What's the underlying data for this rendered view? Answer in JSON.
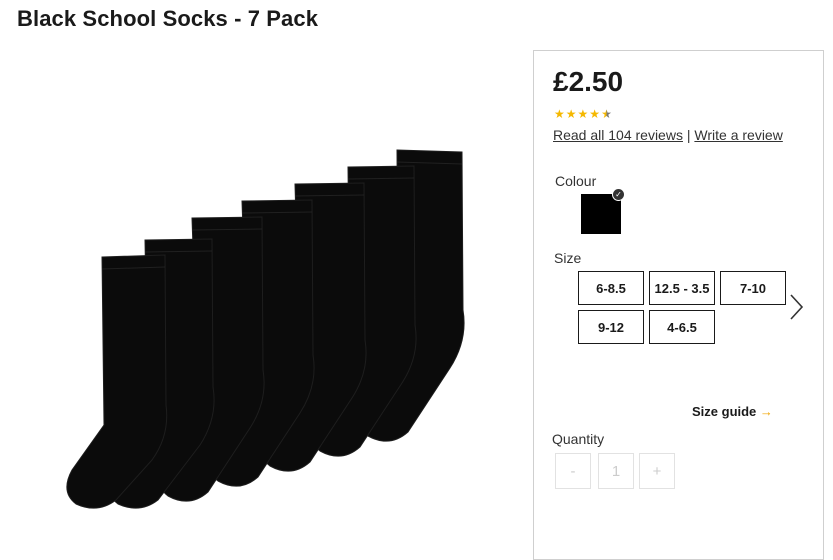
{
  "product": {
    "title": "Black School Socks - 7 Pack",
    "price": "£2.50",
    "rating": 4.5,
    "rating_max": 5,
    "reviews_link": "Read all 104 reviews",
    "separator": "|",
    "write_review": "Write a review"
  },
  "colour": {
    "label": "Colour",
    "selected": "#000000"
  },
  "size": {
    "label": "Size",
    "options": [
      "6-8.5",
      "12.5 - 3.5",
      "7-10",
      "9-12",
      "4-6.5"
    ],
    "guide_label": "Size guide",
    "guide_arrow": "→"
  },
  "quantity": {
    "label": "Quantity",
    "minus": "-",
    "value": "1",
    "plus": "+"
  },
  "icons": {
    "next": "chevron-right-icon",
    "check": "check-icon",
    "star": "star-icon"
  }
}
